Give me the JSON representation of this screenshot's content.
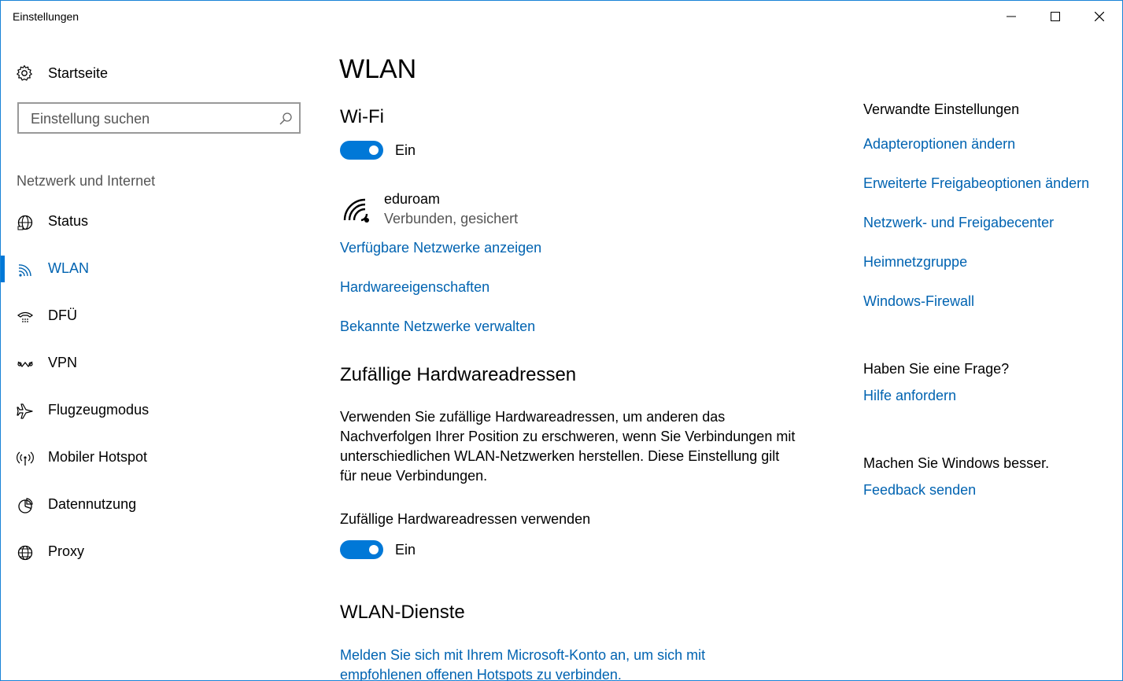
{
  "window": {
    "title": "Einstellungen"
  },
  "sidebar": {
    "home_label": "Startseite",
    "search_placeholder": "Einstellung suchen",
    "section_label": "Netzwerk und Internet",
    "items": [
      {
        "label": "Status",
        "icon": "globe-status-icon"
      },
      {
        "label": "WLAN",
        "icon": "wifi-icon",
        "active": true
      },
      {
        "label": "DFÜ",
        "icon": "dialup-icon"
      },
      {
        "label": "VPN",
        "icon": "vpn-icon"
      },
      {
        "label": "Flugzeugmodus",
        "icon": "airplane-icon"
      },
      {
        "label": "Mobiler Hotspot",
        "icon": "hotspot-icon"
      },
      {
        "label": "Datennutzung",
        "icon": "data-usage-icon"
      },
      {
        "label": "Proxy",
        "icon": "globe-icon"
      }
    ]
  },
  "main": {
    "page_title": "WLAN",
    "wifi": {
      "heading": "Wi-Fi",
      "toggle_state": "Ein",
      "network_name": "eduroam",
      "network_status": "Verbunden, gesichert"
    },
    "links": {
      "show_networks": "Verfügbare Netzwerke anzeigen",
      "hardware_props": "Hardwareeigenschaften",
      "manage_networks": "Bekannte Netzwerke verwalten"
    },
    "random_hw": {
      "heading": "Zufällige Hardwareadressen",
      "description": "Verwenden Sie zufällige Hardwareadressen, um anderen das Nachverfolgen Ihrer Position zu erschweren, wenn Sie Verbindungen mit unterschiedlichen WLAN-Netzwerken herstellen. Diese Einstellung gilt für neue Verbindungen.",
      "toggle_label": "Zufällige Hardwareadressen verwenden",
      "toggle_state": "Ein"
    },
    "wlan_services": {
      "heading": "WLAN-Dienste",
      "link": "Melden Sie sich mit Ihrem Microsoft-Konto an, um sich mit empfohlenen offenen Hotspots zu verbinden."
    }
  },
  "related": {
    "heading": "Verwandte Einstellungen",
    "links": [
      "Adapteroptionen ändern",
      "Erweiterte Freigabeoptionen ändern",
      "Netzwerk- und Freigabecenter",
      "Heimnetzgruppe",
      "Windows-Firewall"
    ],
    "question_heading": "Haben Sie eine Frage?",
    "help_link": "Hilfe anfordern",
    "improve_heading": "Machen Sie Windows besser.",
    "feedback_link": "Feedback senden"
  },
  "colors": {
    "accent": "#0078d7",
    "link": "#0063b1",
    "border": "#1883d7"
  }
}
